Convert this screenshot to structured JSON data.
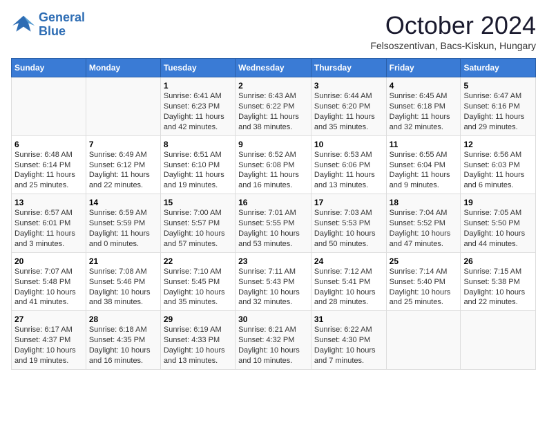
{
  "header": {
    "logo_line1": "General",
    "logo_line2": "Blue",
    "month": "October 2024",
    "location": "Felsoszentivan, Bacs-Kiskun, Hungary"
  },
  "weekdays": [
    "Sunday",
    "Monday",
    "Tuesday",
    "Wednesday",
    "Thursday",
    "Friday",
    "Saturday"
  ],
  "weeks": [
    [
      {
        "day": "",
        "sunrise": "",
        "sunset": "",
        "daylight": ""
      },
      {
        "day": "",
        "sunrise": "",
        "sunset": "",
        "daylight": ""
      },
      {
        "day": "1",
        "sunrise": "Sunrise: 6:41 AM",
        "sunset": "Sunset: 6:23 PM",
        "daylight": "Daylight: 11 hours and 42 minutes."
      },
      {
        "day": "2",
        "sunrise": "Sunrise: 6:43 AM",
        "sunset": "Sunset: 6:22 PM",
        "daylight": "Daylight: 11 hours and 38 minutes."
      },
      {
        "day": "3",
        "sunrise": "Sunrise: 6:44 AM",
        "sunset": "Sunset: 6:20 PM",
        "daylight": "Daylight: 11 hours and 35 minutes."
      },
      {
        "day": "4",
        "sunrise": "Sunrise: 6:45 AM",
        "sunset": "Sunset: 6:18 PM",
        "daylight": "Daylight: 11 hours and 32 minutes."
      },
      {
        "day": "5",
        "sunrise": "Sunrise: 6:47 AM",
        "sunset": "Sunset: 6:16 PM",
        "daylight": "Daylight: 11 hours and 29 minutes."
      }
    ],
    [
      {
        "day": "6",
        "sunrise": "Sunrise: 6:48 AM",
        "sunset": "Sunset: 6:14 PM",
        "daylight": "Daylight: 11 hours and 25 minutes."
      },
      {
        "day": "7",
        "sunrise": "Sunrise: 6:49 AM",
        "sunset": "Sunset: 6:12 PM",
        "daylight": "Daylight: 11 hours and 22 minutes."
      },
      {
        "day": "8",
        "sunrise": "Sunrise: 6:51 AM",
        "sunset": "Sunset: 6:10 PM",
        "daylight": "Daylight: 11 hours and 19 minutes."
      },
      {
        "day": "9",
        "sunrise": "Sunrise: 6:52 AM",
        "sunset": "Sunset: 6:08 PM",
        "daylight": "Daylight: 11 hours and 16 minutes."
      },
      {
        "day": "10",
        "sunrise": "Sunrise: 6:53 AM",
        "sunset": "Sunset: 6:06 PM",
        "daylight": "Daylight: 11 hours and 13 minutes."
      },
      {
        "day": "11",
        "sunrise": "Sunrise: 6:55 AM",
        "sunset": "Sunset: 6:04 PM",
        "daylight": "Daylight: 11 hours and 9 minutes."
      },
      {
        "day": "12",
        "sunrise": "Sunrise: 6:56 AM",
        "sunset": "Sunset: 6:03 PM",
        "daylight": "Daylight: 11 hours and 6 minutes."
      }
    ],
    [
      {
        "day": "13",
        "sunrise": "Sunrise: 6:57 AM",
        "sunset": "Sunset: 6:01 PM",
        "daylight": "Daylight: 11 hours and 3 minutes."
      },
      {
        "day": "14",
        "sunrise": "Sunrise: 6:59 AM",
        "sunset": "Sunset: 5:59 PM",
        "daylight": "Daylight: 11 hours and 0 minutes."
      },
      {
        "day": "15",
        "sunrise": "Sunrise: 7:00 AM",
        "sunset": "Sunset: 5:57 PM",
        "daylight": "Daylight: 10 hours and 57 minutes."
      },
      {
        "day": "16",
        "sunrise": "Sunrise: 7:01 AM",
        "sunset": "Sunset: 5:55 PM",
        "daylight": "Daylight: 10 hours and 53 minutes."
      },
      {
        "day": "17",
        "sunrise": "Sunrise: 7:03 AM",
        "sunset": "Sunset: 5:53 PM",
        "daylight": "Daylight: 10 hours and 50 minutes."
      },
      {
        "day": "18",
        "sunrise": "Sunrise: 7:04 AM",
        "sunset": "Sunset: 5:52 PM",
        "daylight": "Daylight: 10 hours and 47 minutes."
      },
      {
        "day": "19",
        "sunrise": "Sunrise: 7:05 AM",
        "sunset": "Sunset: 5:50 PM",
        "daylight": "Daylight: 10 hours and 44 minutes."
      }
    ],
    [
      {
        "day": "20",
        "sunrise": "Sunrise: 7:07 AM",
        "sunset": "Sunset: 5:48 PM",
        "daylight": "Daylight: 10 hours and 41 minutes."
      },
      {
        "day": "21",
        "sunrise": "Sunrise: 7:08 AM",
        "sunset": "Sunset: 5:46 PM",
        "daylight": "Daylight: 10 hours and 38 minutes."
      },
      {
        "day": "22",
        "sunrise": "Sunrise: 7:10 AM",
        "sunset": "Sunset: 5:45 PM",
        "daylight": "Daylight: 10 hours and 35 minutes."
      },
      {
        "day": "23",
        "sunrise": "Sunrise: 7:11 AM",
        "sunset": "Sunset: 5:43 PM",
        "daylight": "Daylight: 10 hours and 32 minutes."
      },
      {
        "day": "24",
        "sunrise": "Sunrise: 7:12 AM",
        "sunset": "Sunset: 5:41 PM",
        "daylight": "Daylight: 10 hours and 28 minutes."
      },
      {
        "day": "25",
        "sunrise": "Sunrise: 7:14 AM",
        "sunset": "Sunset: 5:40 PM",
        "daylight": "Daylight: 10 hours and 25 minutes."
      },
      {
        "day": "26",
        "sunrise": "Sunrise: 7:15 AM",
        "sunset": "Sunset: 5:38 PM",
        "daylight": "Daylight: 10 hours and 22 minutes."
      }
    ],
    [
      {
        "day": "27",
        "sunrise": "Sunrise: 6:17 AM",
        "sunset": "Sunset: 4:37 PM",
        "daylight": "Daylight: 10 hours and 19 minutes."
      },
      {
        "day": "28",
        "sunrise": "Sunrise: 6:18 AM",
        "sunset": "Sunset: 4:35 PM",
        "daylight": "Daylight: 10 hours and 16 minutes."
      },
      {
        "day": "29",
        "sunrise": "Sunrise: 6:19 AM",
        "sunset": "Sunset: 4:33 PM",
        "daylight": "Daylight: 10 hours and 13 minutes."
      },
      {
        "day": "30",
        "sunrise": "Sunrise: 6:21 AM",
        "sunset": "Sunset: 4:32 PM",
        "daylight": "Daylight: 10 hours and 10 minutes."
      },
      {
        "day": "31",
        "sunrise": "Sunrise: 6:22 AM",
        "sunset": "Sunset: 4:30 PM",
        "daylight": "Daylight: 10 hours and 7 minutes."
      },
      {
        "day": "",
        "sunrise": "",
        "sunset": "",
        "daylight": ""
      },
      {
        "day": "",
        "sunrise": "",
        "sunset": "",
        "daylight": ""
      }
    ]
  ]
}
